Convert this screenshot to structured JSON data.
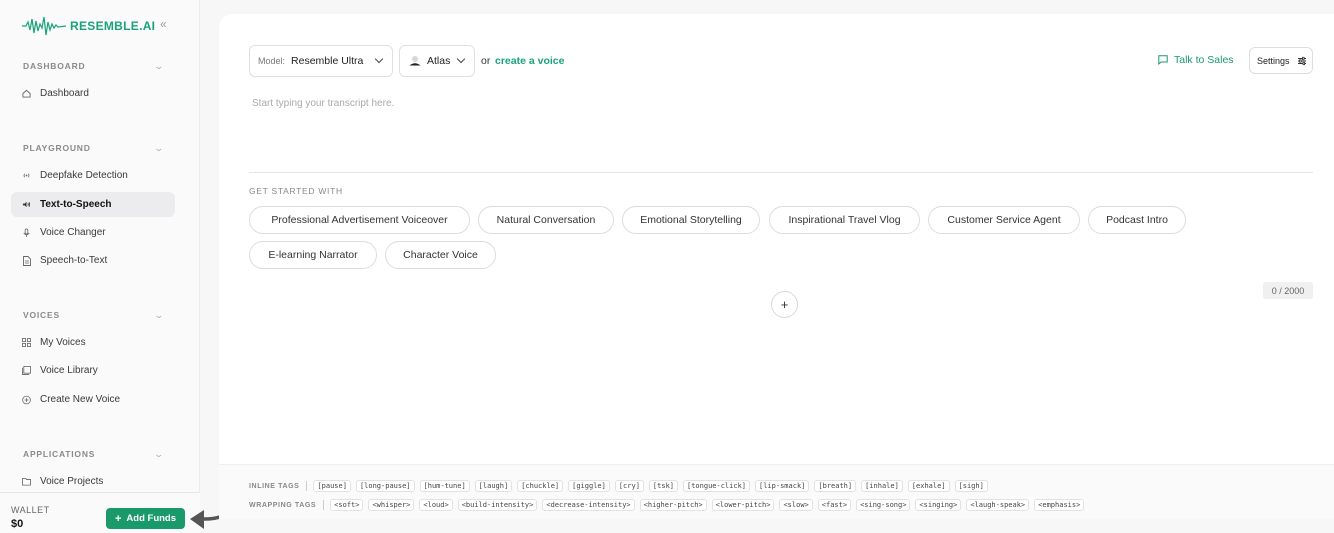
{
  "brand": {
    "name": "RESEMBLE.AI",
    "accent": "#1aa37a"
  },
  "sidebar": {
    "sections": [
      {
        "title": "DASHBOARD",
        "items": [
          {
            "label": "Dashboard",
            "icon": "home-icon"
          }
        ]
      },
      {
        "title": "PLAYGROUND",
        "items": [
          {
            "label": "Deepfake Detection",
            "icon": "radio-waves-icon"
          },
          {
            "label": "Text-to-Speech",
            "icon": "speaker-icon",
            "active": true
          },
          {
            "label": "Voice Changer",
            "icon": "microphone-icon"
          },
          {
            "label": "Speech-to-Text",
            "icon": "document-icon"
          }
        ]
      },
      {
        "title": "VOICES",
        "items": [
          {
            "label": "My Voices",
            "icon": "grid-icon"
          },
          {
            "label": "Voice Library",
            "icon": "library-icon"
          },
          {
            "label": "Create New Voice",
            "icon": "plus-circle-icon"
          }
        ]
      },
      {
        "title": "APPLICATIONS",
        "items": [
          {
            "label": "Voice Projects",
            "icon": "folder-icon"
          }
        ]
      }
    ],
    "wallet": {
      "label": "WALLET",
      "value": "$0",
      "add_funds": "Add Funds"
    }
  },
  "toolbar": {
    "model_key": "Model:",
    "model_value": "Resemble Ultra",
    "voice_value": "Atlas",
    "or_text": "or",
    "create_voice": "create a voice",
    "talk_to_sales": "Talk to Sales",
    "settings": "Settings"
  },
  "editor": {
    "placeholder": "Start typing your transcript here.",
    "get_started_title": "GET STARTED WITH",
    "suggestions": [
      "Professional Advertisement Voiceover",
      "Natural Conversation",
      "Emotional Storytelling",
      "Inspirational Travel Vlog",
      "Customer Service Agent",
      "Podcast Intro",
      "E-learning Narrator",
      "Character Voice"
    ],
    "char_count": "0 / 2000"
  },
  "tags": {
    "inline_title": "INLINE TAGS",
    "inline": [
      "[pause]",
      "[long-pause]",
      "[hum-tune]",
      "[laugh]",
      "[chuckle]",
      "[giggle]",
      "[cry]",
      "[tsk]",
      "[tongue-click]",
      "[lip-smack]",
      "[breath]",
      "[inhale]",
      "[exhale]",
      "[sigh]"
    ],
    "wrapping_title": "WRAPPING TAGS",
    "wrapping": [
      "<soft>",
      "<whisper>",
      "<loud>",
      "<build-intensity>",
      "<decrease-intensity>",
      "<higher-pitch>",
      "<lower-pitch>",
      "<slow>",
      "<fast>",
      "<sing-song>",
      "<singing>",
      "<laugh-speak>",
      "<emphasis>"
    ]
  }
}
